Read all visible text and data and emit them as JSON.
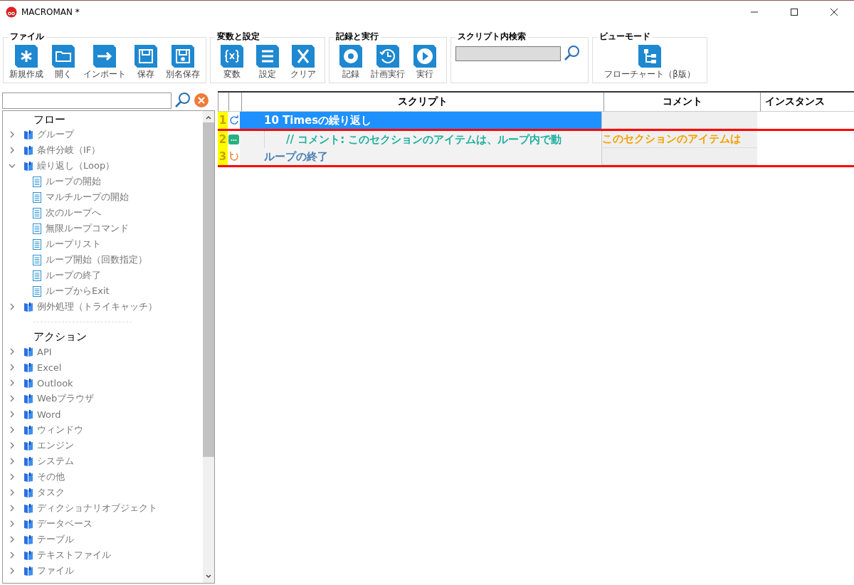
{
  "window": {
    "title": "MACROMAN *"
  },
  "ribbon": [
    {
      "title": "ファイル",
      "kind": "buttons",
      "buttons": [
        "新規作成",
        "開く",
        "インポート",
        "保存",
        "別名保存"
      ]
    },
    {
      "title": "変数と設定",
      "kind": "buttons",
      "buttons": [
        "変数",
        "設定",
        "クリア"
      ]
    },
    {
      "title": "記録と実行",
      "kind": "buttons",
      "buttons": [
        "記録",
        "計画実行",
        "実行"
      ]
    },
    {
      "title": "スクリプト内検索",
      "kind": "search"
    },
    {
      "title": "ビューモード",
      "kind": "view",
      "buttons": [
        "フローチャート（β版）"
      ]
    }
  ],
  "sidebar": {
    "sections": [
      {
        "title": "フロー",
        "items": [
          {
            "label": "グループ",
            "kind": "group",
            "expanded": false
          },
          {
            "label": "条件分岐（IF）",
            "kind": "group",
            "expanded": false
          },
          {
            "label": "繰り返し（Loop）",
            "kind": "group",
            "expanded": true,
            "children": [
              {
                "label": "ループの開始",
                "kind": "command"
              },
              {
                "label": "マルチループの開始",
                "kind": "command"
              },
              {
                "label": "次のループへ",
                "kind": "command"
              },
              {
                "label": "無限ループコマンド",
                "kind": "command"
              },
              {
                "label": "ループリスト",
                "kind": "command"
              },
              {
                "label": "ループ開始（回数指定）",
                "kind": "command"
              },
              {
                "label": "ループの終了",
                "kind": "command"
              },
              {
                "label": "ループからExit",
                "kind": "command"
              }
            ]
          },
          {
            "label": "例外処理（トライキャッチ）",
            "kind": "group",
            "expanded": false
          }
        ]
      },
      {
        "title": "アクション",
        "items": [
          {
            "label": "API",
            "kind": "group",
            "expanded": false
          },
          {
            "label": "Excel",
            "kind": "group",
            "expanded": false
          },
          {
            "label": "Outlook",
            "kind": "group",
            "expanded": false
          },
          {
            "label": "Webブラウザ",
            "kind": "group",
            "expanded": false
          },
          {
            "label": "Word",
            "kind": "group",
            "expanded": false
          },
          {
            "label": "ウィンドウ",
            "kind": "group",
            "expanded": false
          },
          {
            "label": "エンジン",
            "kind": "group",
            "expanded": false
          },
          {
            "label": "システム",
            "kind": "group",
            "expanded": false
          },
          {
            "label": "その他",
            "kind": "group",
            "expanded": false
          },
          {
            "label": "タスク",
            "kind": "group",
            "expanded": false
          },
          {
            "label": "ディクショナリオブジェクト",
            "kind": "group",
            "expanded": false
          },
          {
            "label": "データベース",
            "kind": "group",
            "expanded": false
          },
          {
            "label": "テーブル",
            "kind": "group",
            "expanded": false
          },
          {
            "label": "テキストファイル",
            "kind": "group",
            "expanded": false
          },
          {
            "label": "ファイル",
            "kind": "group",
            "expanded": false
          }
        ]
      }
    ]
  },
  "table": {
    "columns": [
      "スクリプト",
      "コメント",
      "インスタンス"
    ],
    "rows": [
      {
        "number": "1",
        "kind": "loop",
        "text": "10 Timesの繰り返し",
        "selected": true,
        "children": [
          {
            "number": "2",
            "kind": "comment",
            "text": "// コメント: このセクションのアイテムは、ループ内で動",
            "comment": "このセクションのアイテムは",
            "selected": false
          }
        ]
      },
      {
        "number": "3",
        "kind": "loop_end",
        "text": "ループの終了",
        "selected": false
      }
    ]
  }
}
